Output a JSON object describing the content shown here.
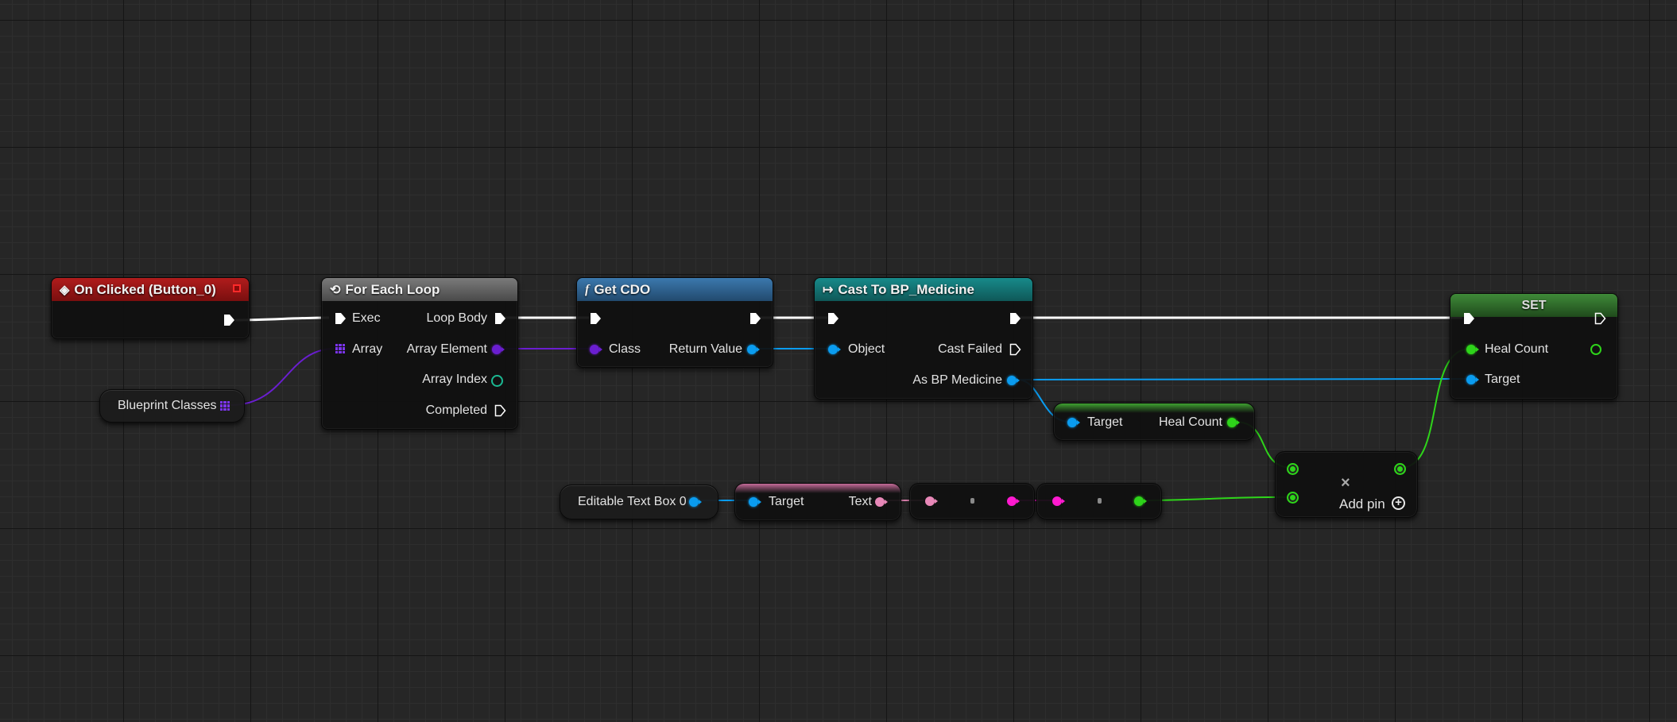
{
  "graph": {
    "event_node": {
      "title": "On Clicked (Button_0)"
    },
    "var_node": {
      "label": "Blueprint Classes"
    },
    "foreach_node": {
      "title": "For Each Loop",
      "exec_label": "Exec",
      "array_label": "Array",
      "loop_body_label": "Loop Body",
      "array_element_label": "Array Element",
      "array_index_label": "Array Index",
      "completed_label": "Completed"
    },
    "getcdo_node": {
      "title": "Get CDO",
      "class_label": "Class",
      "return_label": "Return Value"
    },
    "cast_node": {
      "title": "Cast To BP_Medicine",
      "object_label": "Object",
      "cast_failed_label": "Cast Failed",
      "as_label": "As BP Medicine"
    },
    "get_heal_node": {
      "target_label": "Target",
      "heal_count_label": "Heal Count"
    },
    "textbox_node": {
      "label": "Editable Text Box 0"
    },
    "gettext_node": {
      "target_label": "Target",
      "text_label": "Text"
    },
    "add_node": {
      "add_pin_label": "Add pin"
    },
    "set_node": {
      "title": "SET",
      "heal_count_label": "Heal Count",
      "target_label": "Target"
    }
  },
  "colors": {
    "event_header": "#8e1414",
    "foreach_header": "#5a5a5a",
    "function_header": "#2c5d87",
    "cast_header": "#136d6d",
    "set_header": "#2f6b2a",
    "exec_wire": "#ffffff",
    "object_wire": "#0a9cf0",
    "class_wire": "#6a1ed0",
    "int_wire": "#2ed41a",
    "text_wire": "#e888b8",
    "string_wire": "#ff1ad0"
  }
}
